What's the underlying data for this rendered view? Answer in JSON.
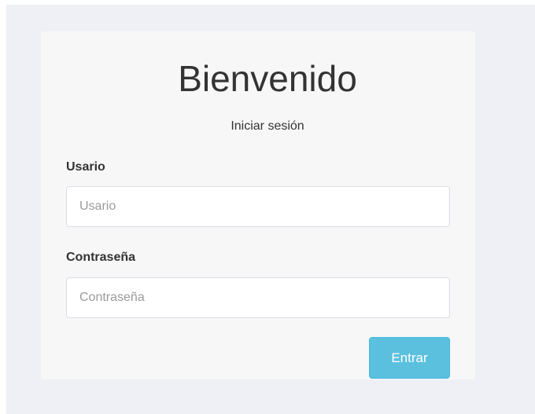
{
  "login": {
    "title": "Bienvenido",
    "subtitle": "Iniciar sesión",
    "username": {
      "label": "Usario",
      "placeholder": "Usario",
      "value": ""
    },
    "password": {
      "label": "Contraseña",
      "placeholder": "Contraseña",
      "value": ""
    },
    "submit_label": "Entrar"
  },
  "colors": {
    "page_background": "#eef0f5",
    "card_background": "#f7f7f8",
    "button": "#5bc0de",
    "text": "#333333"
  }
}
